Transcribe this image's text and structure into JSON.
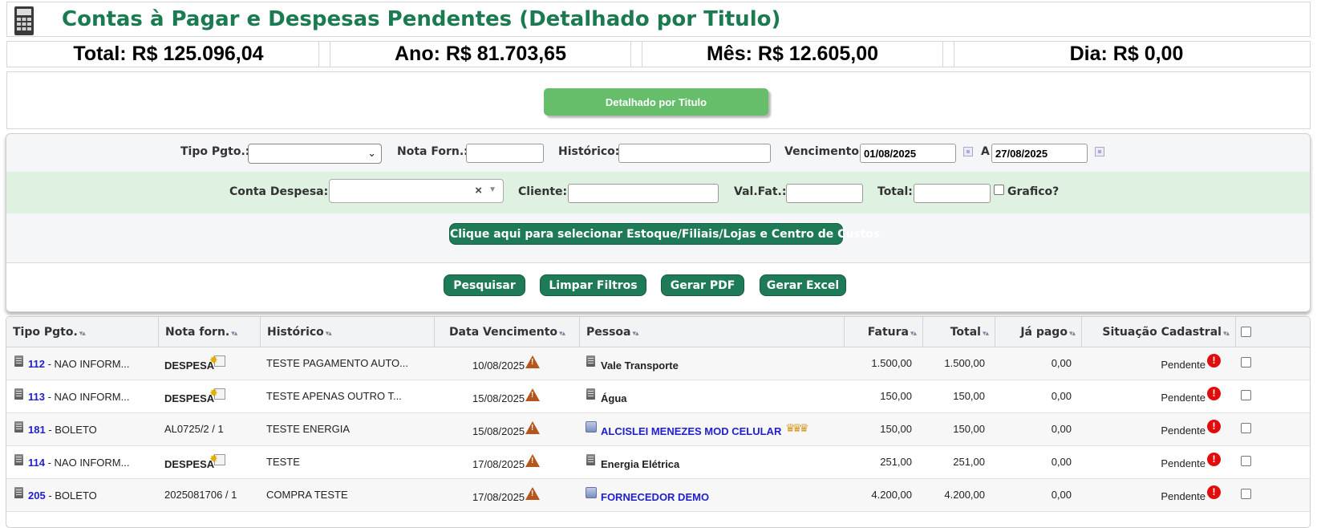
{
  "header": {
    "title": "Contas à Pagar e Despesas Pendentes (Detalhado por Titulo)"
  },
  "totals": [
    "Total: R$ 125.096,04",
    "Ano: R$ 81.703,65",
    "Mês: R$ 12.605,00",
    "Dia: R$ 0,00"
  ],
  "mode_button": "Detalhado por Titulo",
  "filters": {
    "tipo_pgto_label": "Tipo Pgto.:",
    "nota_forn_label": "Nota Forn.:",
    "historico_label": "Histórico:",
    "vencimento_label": "Vencimento:",
    "vencimento_de": "01/08/2025",
    "a_label": "A",
    "vencimento_ate": "27/08/2025",
    "conta_despesa_label": "Conta Despesa:",
    "clear_symbol": "×",
    "cliente_label": "Cliente:",
    "valfat_label": "Val.Fat.:",
    "total_label": "Total:",
    "grafico_label": "Grafico?"
  },
  "buttons": {
    "select_estoque": "Clique aqui para selecionar Estoque/Filiais/Lojas e Centro de Custos",
    "pesquisar": "Pesquisar",
    "limpar": "Limpar Filtros",
    "gerar_pdf": "Gerar PDF",
    "gerar_excel": "Gerar Excel"
  },
  "table": {
    "sort_symbol": "▾▴",
    "columns": [
      "Tipo Pgto.",
      "Nota forn.",
      "Histórico",
      "Data Vencimento",
      "Pessoa",
      "Fatura",
      "Total",
      "Já pago",
      "Situação Cadastral"
    ],
    "rows": [
      {
        "code": "112",
        "tipo": " - NAO INFORM...",
        "nota": "DESPESA",
        "historico": "TESTE PAGAMENTO AUTO...",
        "vencimento": "10/08/2025",
        "pessoa": "Vale Transporte",
        "fatura": "1.500,00",
        "total": "1.500,00",
        "pago": "0,00",
        "situacao": "Pendente"
      },
      {
        "code": "113",
        "tipo": " - NAO INFORM...",
        "nota": "DESPESA",
        "historico": "TESTE APENAS OUTRO T...",
        "vencimento": "15/08/2025",
        "pessoa": "Água",
        "fatura": "150,00",
        "total": "150,00",
        "pago": "0,00",
        "situacao": "Pendente"
      },
      {
        "code": "181",
        "tipo": " - BOLETO",
        "nota": "AL0725/2 / 1",
        "historico": "TESTE ENERGIA",
        "vencimento": "15/08/2025",
        "pessoa": "ALCISLEI MENEZES MOD CELULAR",
        "fatura": "150,00",
        "total": "150,00",
        "pago": "0,00",
        "situacao": "Pendente"
      },
      {
        "code": "114",
        "tipo": " - NAO INFORM...",
        "nota": "DESPESA",
        "historico": "TESTE",
        "vencimento": "17/08/2025",
        "pessoa": "Energia Elétrica",
        "fatura": "251,00",
        "total": "251,00",
        "pago": "0,00",
        "situacao": "Pendente"
      },
      {
        "code": "205",
        "tipo": " - BOLETO",
        "nota": "2025081706 / 1",
        "historico": "COMPRA TESTE",
        "vencimento": "17/08/2025",
        "pessoa": "FORNECEDOR DEMO",
        "fatura": "4.200,00",
        "total": "4.200,00",
        "pago": "0,00",
        "situacao": "Pendente"
      }
    ]
  },
  "colors": {
    "title": "#1a7a50",
    "mode_button": "#66bd6a",
    "action_button": "#1e7a57",
    "green_row": "#dff2e1",
    "link": "#1f1fcf",
    "alert": "#e10d0d",
    "warning": "#b5561c"
  }
}
